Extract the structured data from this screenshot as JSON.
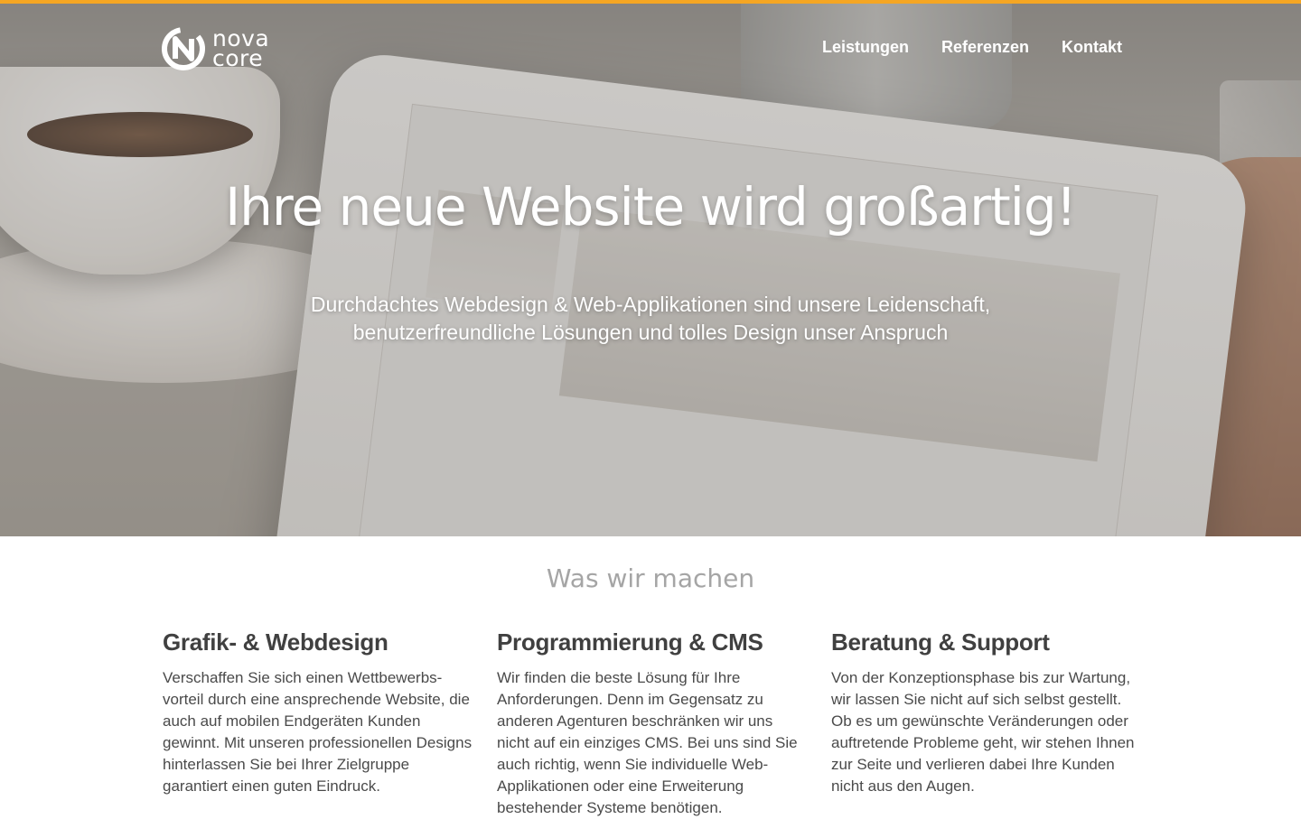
{
  "nav": {
    "logo": {
      "line1": "nova",
      "line2": "core"
    },
    "items": [
      {
        "label": "Leistungen"
      },
      {
        "label": "Referenzen"
      },
      {
        "label": "Kontakt"
      }
    ]
  },
  "hero": {
    "title": "Ihre neue Website wird großartig!",
    "subtitle_line1": "Durchdachtes Webdesign & Web-Applikationen sind unsere Leidenschaft,",
    "subtitle_line2": "benutzerfreundliche Lösungen und tolles Design unser Anspruch"
  },
  "services": {
    "title": "Was wir machen",
    "columns": [
      {
        "heading": "Grafik- & Webdesign",
        "text": "Verschaffen Sie sich einen Wettbewerbs-vorteil durch eine ansprechende Website, die auch auf mobilen Endgeräten Kunden gewinnt. Mit unseren professionellen Designs hinterlassen Sie bei Ihrer Zielgruppe garantiert einen guten Eindruck."
      },
      {
        "heading": "Programmierung & CMS",
        "text": "Wir finden die beste Lösung für Ihre Anforderungen. Denn im Gegensatz zu anderen Agenturen beschränken wir uns nicht auf ein einziges CMS. Bei uns sind Sie auch richtig, wenn Sie individuelle Web-Applikationen oder eine Erweiterung bestehender Systeme benötigen."
      },
      {
        "heading": "Beratung & Support",
        "text": "Von der Konzeptionsphase bis zur Wartung, wir lassen Sie nicht auf sich selbst gestellt. Ob es um gewünschte Veränderungen oder auftretende Probleme geht, wir stehen Ihnen zur Seite und verlieren dabei Ihre Kunden nicht aus den Augen."
      }
    ]
  },
  "colors": {
    "accent": "#f5a623",
    "heading": "#404040",
    "section_title": "#a5a5a5"
  }
}
